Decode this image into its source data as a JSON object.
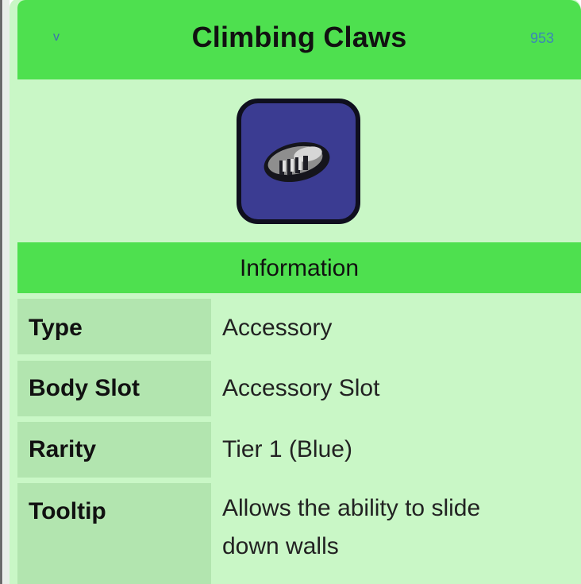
{
  "infobox": {
    "title": "Climbing Claws",
    "version_link": "v",
    "item_id": "953",
    "section_header": "Information",
    "rows": [
      {
        "label": "Type",
        "value": "Accessory"
      },
      {
        "label": "Body Slot",
        "value": "Accessory Slot"
      },
      {
        "label": "Rarity",
        "value": "Tier 1 (Blue)"
      },
      {
        "label": "Tooltip",
        "value_line1": "Allows the ability to slide",
        "value_line2": "down walls"
      }
    ]
  },
  "colors": {
    "header_green": "#4ee04f",
    "panel_green": "#c9f7c6",
    "label_green": "#b2e5af",
    "link_blue": "#3d5fa8",
    "rarity_blue": "#2d3fc8",
    "icon_slot": "#3b3c92"
  },
  "icons": {
    "item_icon": "climbing-claws-icon"
  }
}
